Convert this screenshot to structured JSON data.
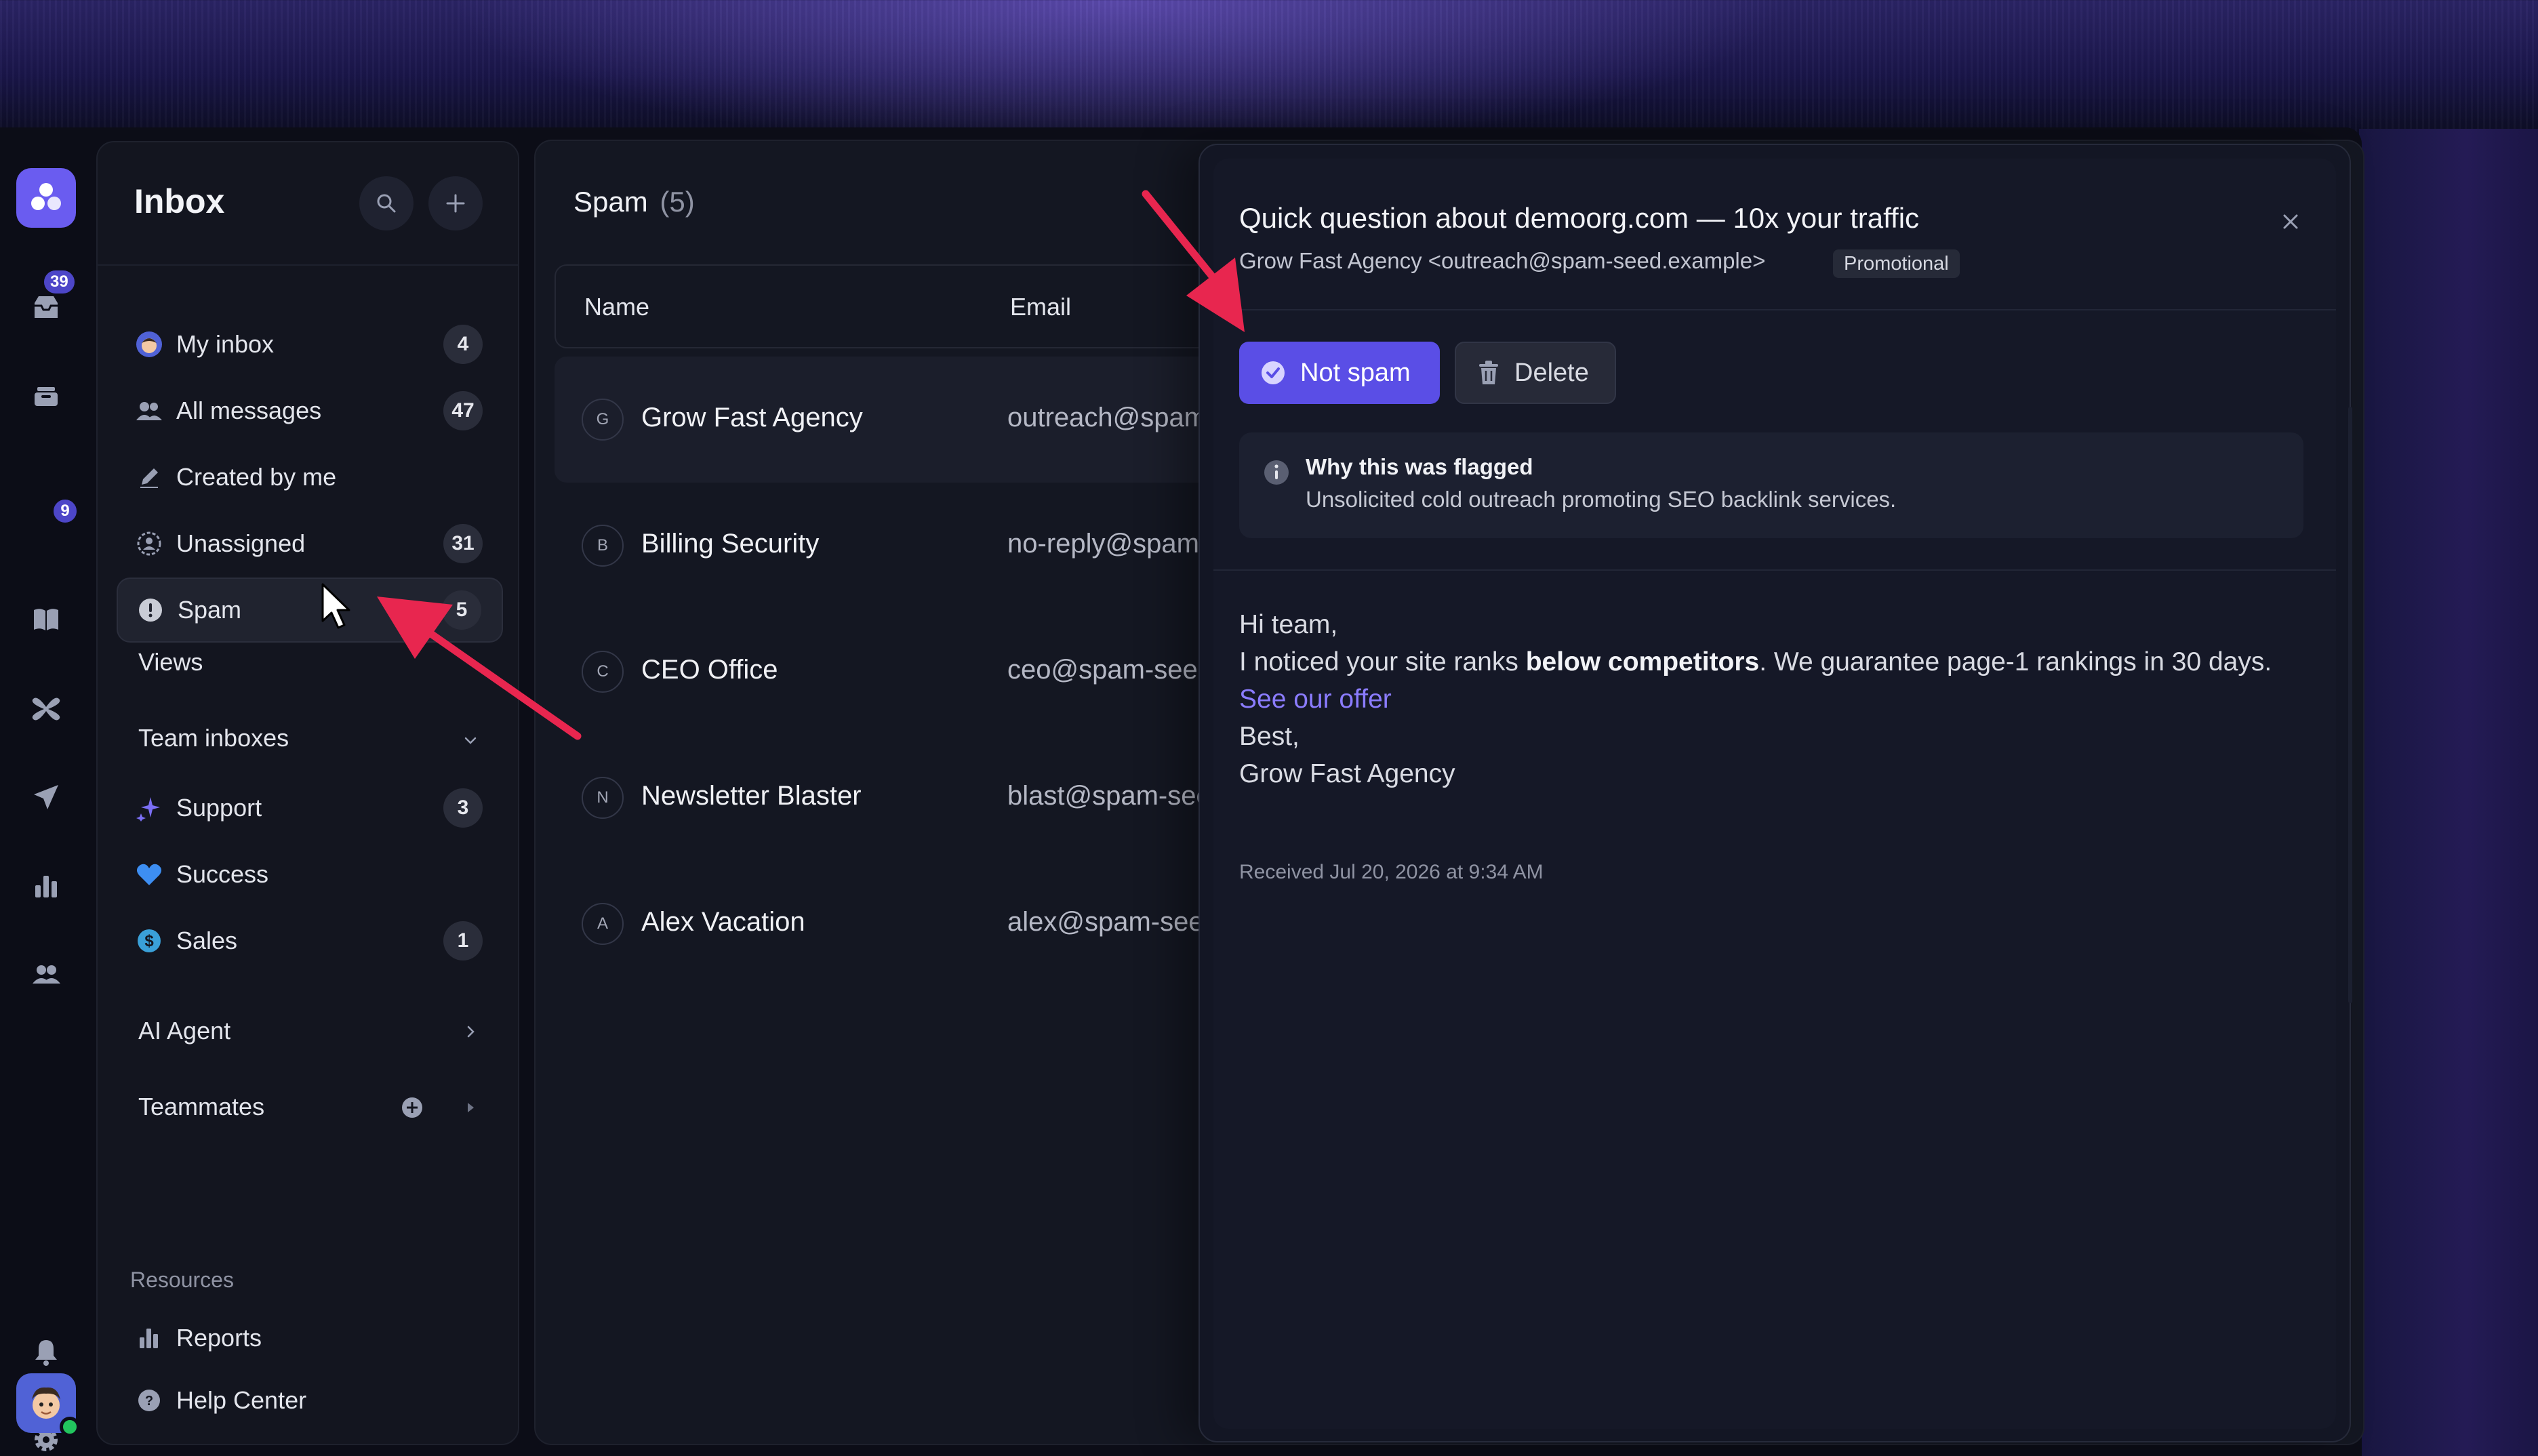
{
  "rail": {
    "inbox_badge": "39",
    "tray_badge": "9"
  },
  "sidebar": {
    "title": "Inbox",
    "items": [
      {
        "label": "My inbox",
        "count": "4"
      },
      {
        "label": "All messages",
        "count": "47"
      },
      {
        "label": "Created by me",
        "count": ""
      },
      {
        "label": "Unassigned",
        "count": "31"
      },
      {
        "label": "Spam",
        "count": "5"
      }
    ],
    "views_label": "Views",
    "team_inboxes_label": "Team inboxes",
    "team_items": [
      {
        "label": "Support",
        "count": "3"
      },
      {
        "label": "Success",
        "count": ""
      },
      {
        "label": "Sales",
        "count": "1"
      }
    ],
    "ai_agent_label": "AI Agent",
    "teammates_label": "Teammates",
    "resources_label": "Resources",
    "resources": [
      {
        "label": "Reports"
      },
      {
        "label": "Help Center"
      }
    ]
  },
  "list": {
    "title": "Spam",
    "count": "(5)",
    "columns": [
      "Name",
      "Email"
    ],
    "rows": [
      {
        "initial": "G",
        "name": "Grow Fast Agency",
        "email": "outreach@spam-"
      },
      {
        "initial": "B",
        "name": "Billing Security",
        "email": "no-reply@spam-"
      },
      {
        "initial": "C",
        "name": "CEO Office",
        "email": "ceo@spam-seed"
      },
      {
        "initial": "N",
        "name": "Newsletter Blaster",
        "email": "blast@spam-see"
      },
      {
        "initial": "A",
        "name": "Alex Vacation",
        "email": "alex@spam-seed"
      }
    ]
  },
  "detail": {
    "subject": "Quick question about demoorg.com — 10x your traffic",
    "from": "Grow Fast Agency <outreach@spam-seed.example>",
    "tag": "Promotional",
    "not_spam_label": "Not spam",
    "delete_label": "Delete",
    "flag_title": "Why this was flagged",
    "flag_desc": "Unsolicited cold outreach promoting SEO backlink services.",
    "body": {
      "greeting": "Hi team,",
      "line_pre": "I noticed your site ranks ",
      "line_bold": "below competitors",
      "line_post": ". We guarantee page-1 rankings in 30 days.",
      "link": "See our offer",
      "signoff": "Best,",
      "signature": "Grow Fast Agency"
    },
    "received": "Received Jul 20, 2026 at 9:34 AM"
  },
  "colors": {
    "accent": "#5a4ee6",
    "annotation_arrow": "#e8264f",
    "link": "#8b7cff"
  }
}
